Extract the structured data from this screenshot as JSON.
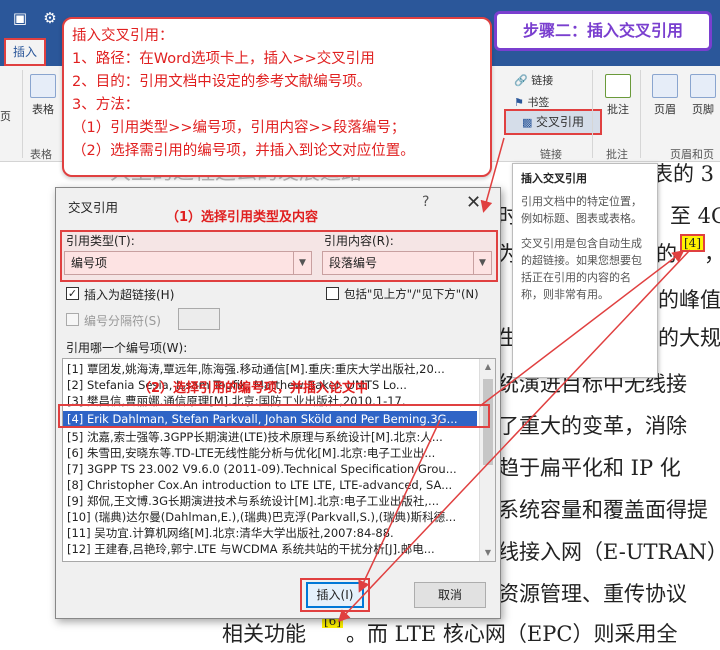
{
  "ribbon": {
    "active_tab": "插入",
    "partial_left": "页",
    "table_btn": "表格",
    "table_group": "表格",
    "link_btn": "链接",
    "bookmark_btn": "书签",
    "cross_ref_btn": "交叉引用",
    "links_group": "链接",
    "comment_btn": "批注",
    "comment_group": "批注",
    "header_btn": "页眉",
    "footer_btn": "页脚",
    "header_footer_group": "页眉和页"
  },
  "annotation": {
    "lines": [
      "插入交叉引用：",
      "1、路径：在Word选项卡上，插入>>交叉引用",
      "2、目的：引用文档中设定的参考文献编号项。",
      "3、方法：",
      "（1）引用类型>>编号项，引用内容>>段落编号；",
      "（2）选择需引用的编号项，并插入到论文对应位置。"
    ],
    "step": "步骤二：插入交叉引用"
  },
  "tooltip": {
    "title": "插入交叉引用",
    "p1": "引用文档中的特定位置，例如标题、图表或表格。",
    "p2": "交叉引用是包含自动生成的超链接。如果您想要包括正在引用的内容的名称，则非常有用。"
  },
  "doc": {
    "lines": [
      "大上的过程这么的发展道路",
      "表的 3",
      "时，",
      "至 4G",
      "为",
      "的",
      "[4]",
      "，",
      "的峰值",
      "生",
      "的大规",
      "统演进目标中无线接",
      "了重大的变革，消除",
      "趋于扁平化和 IP 化",
      "系统容量和覆盖面得提",
      "线接入网（E-UTRAN）",
      "资源管理、重传协议",
      "相关功能",
      "[6]",
      "。而 LTE 核心网（EPC）则采用全"
    ]
  },
  "dialog": {
    "title": "交叉引用",
    "help": "?",
    "close": "✕",
    "annot1": "（1）选择引用类型及内容",
    "ref_type_label": "引用类型(T):",
    "ref_type_value": "编号项",
    "ref_content_label": "引用内容(R):",
    "ref_content_value": "段落编号",
    "hyperlink_label": "插入为超链接(H)",
    "hyperlink_checked": true,
    "above_below_label": "包括\"见上方\"/\"见下方\"(N)",
    "separator_label": "编号分隔符(S)",
    "which_label": "引用哪一个编号项(W):",
    "annot2": "（2）选择引用的编号项，并插入论文中",
    "items": [
      "[1] 覃团发,姚海涛,覃远年,陈海强.移动通信[M].重庆:重庆大学出版社,20...",
      "[2] Stefania Sesia, Issam Toufik, Matthew Baker. UMTS Lo...",
      "[3] 樊昌信,曹丽娜.通信原理[M].北京:国防工业出版社,2010.1-17.",
      "[4] Erik Dahlman, Stefan Parkvall, Johan Sköld and Per Beming.3G...",
      "[5] 沈嘉,索士强等.3GPP长期演进(LTE)技术原理与系统设计[M].北京:人...",
      "[6] 朱雪田,安晓东等.TD-LTE无线性能分析与优化[M].北京:电子工业出...",
      "[7] 3GPP TS 23.002 V9.6.0 (2011-09).Technical Specification Grou...",
      "[8] Christopher Cox.An introduction to LTE LTE, LTE-advanced, SA...",
      "[9] 郑侃,王文博.3G长期演进技术与系统设计[M].北京:电子工业出版社,...",
      "[10] (瑞典)达尔曼(Dahlman,E.),(瑞典)巴克浮(Parkvall,S.),(瑞典)斯科德...",
      "[11] 吴功宜.计算机网络[M].北京:清华大学出版社,2007:84-88.",
      "[12] 王建春,吕艳玲,郭宁.LTE 与WCDMA 系统共站的干扰分析[J].邮电..."
    ],
    "selected_index": 3,
    "insert_btn": "插入(I)",
    "cancel_btn": "取消"
  },
  "colors": {
    "brand": "#2b579a",
    "annotation_red": "#e02020",
    "step_purple": "#7a3fcf",
    "selection_blue": "#2f64c6",
    "highlight": "#fff200"
  }
}
